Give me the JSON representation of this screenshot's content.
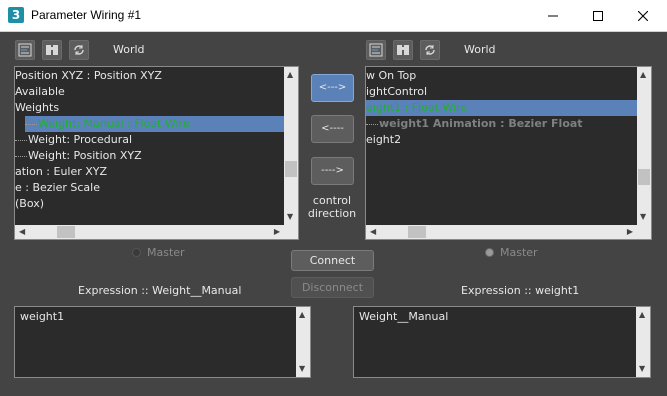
{
  "window": {
    "app_icon": "3",
    "title": "Parameter Wiring #1",
    "controls": {
      "minimize": "—",
      "maximize": "☐",
      "close": "✕"
    }
  },
  "left_panel": {
    "world_label": "World",
    "toolbar_icons": [
      "track-view-icon",
      "find-icon",
      "refresh-icon"
    ],
    "tree_rows": [
      {
        "text": "Position XYZ : Position XYZ",
        "indent": 0,
        "style": "normal"
      },
      {
        "text": "Available",
        "indent": 0,
        "style": "normal"
      },
      {
        "text": "Weights",
        "indent": 0,
        "style": "normal"
      },
      {
        "text": "Weight: Manual : Float Wire",
        "indent": 1,
        "style": "selected-green"
      },
      {
        "text": "Weight: Procedural",
        "indent": 1,
        "style": "normal"
      },
      {
        "text": "Weight: Position XYZ",
        "indent": 1,
        "style": "normal"
      },
      {
        "text": "ation : Euler XYZ",
        "indent": 0,
        "style": "normal"
      },
      {
        "text": "e : Bezier Scale",
        "indent": 0,
        "style": "normal"
      },
      {
        "text": "(Box)",
        "indent": 0,
        "style": "normal"
      }
    ],
    "master_label": "Master",
    "master_selected": false,
    "expression_label": "Expression :: Weight__Manual",
    "expression_value": "weight1"
  },
  "right_panel": {
    "world_label": "World",
    "toolbar_icons": [
      "track-view-icon",
      "find-icon",
      "refresh-icon"
    ],
    "tree_rows": [
      {
        "text": "w On Top",
        "indent": 0,
        "style": "normal"
      },
      {
        "text": "ightControl",
        "indent": 0,
        "style": "normal"
      },
      {
        "text": "eight1 : Float Wire",
        "indent": 0,
        "style": "selected-green"
      },
      {
        "text": "weight1 Animation : Bezier Float",
        "indent": 1,
        "style": "dim"
      },
      {
        "text": "eight2",
        "indent": 0,
        "style": "normal"
      }
    ],
    "master_label": "Master",
    "master_selected": true,
    "expression_label": "Expression :: weight1",
    "expression_value": "Weight__Manual"
  },
  "direction_buttons": {
    "both": "<--->",
    "to_left": "<----",
    "to_right": "---->",
    "active": "both"
  },
  "control_direction_label": [
    "control",
    "direction"
  ],
  "connect_label": "Connect",
  "disconnect_label": "Disconnect"
}
